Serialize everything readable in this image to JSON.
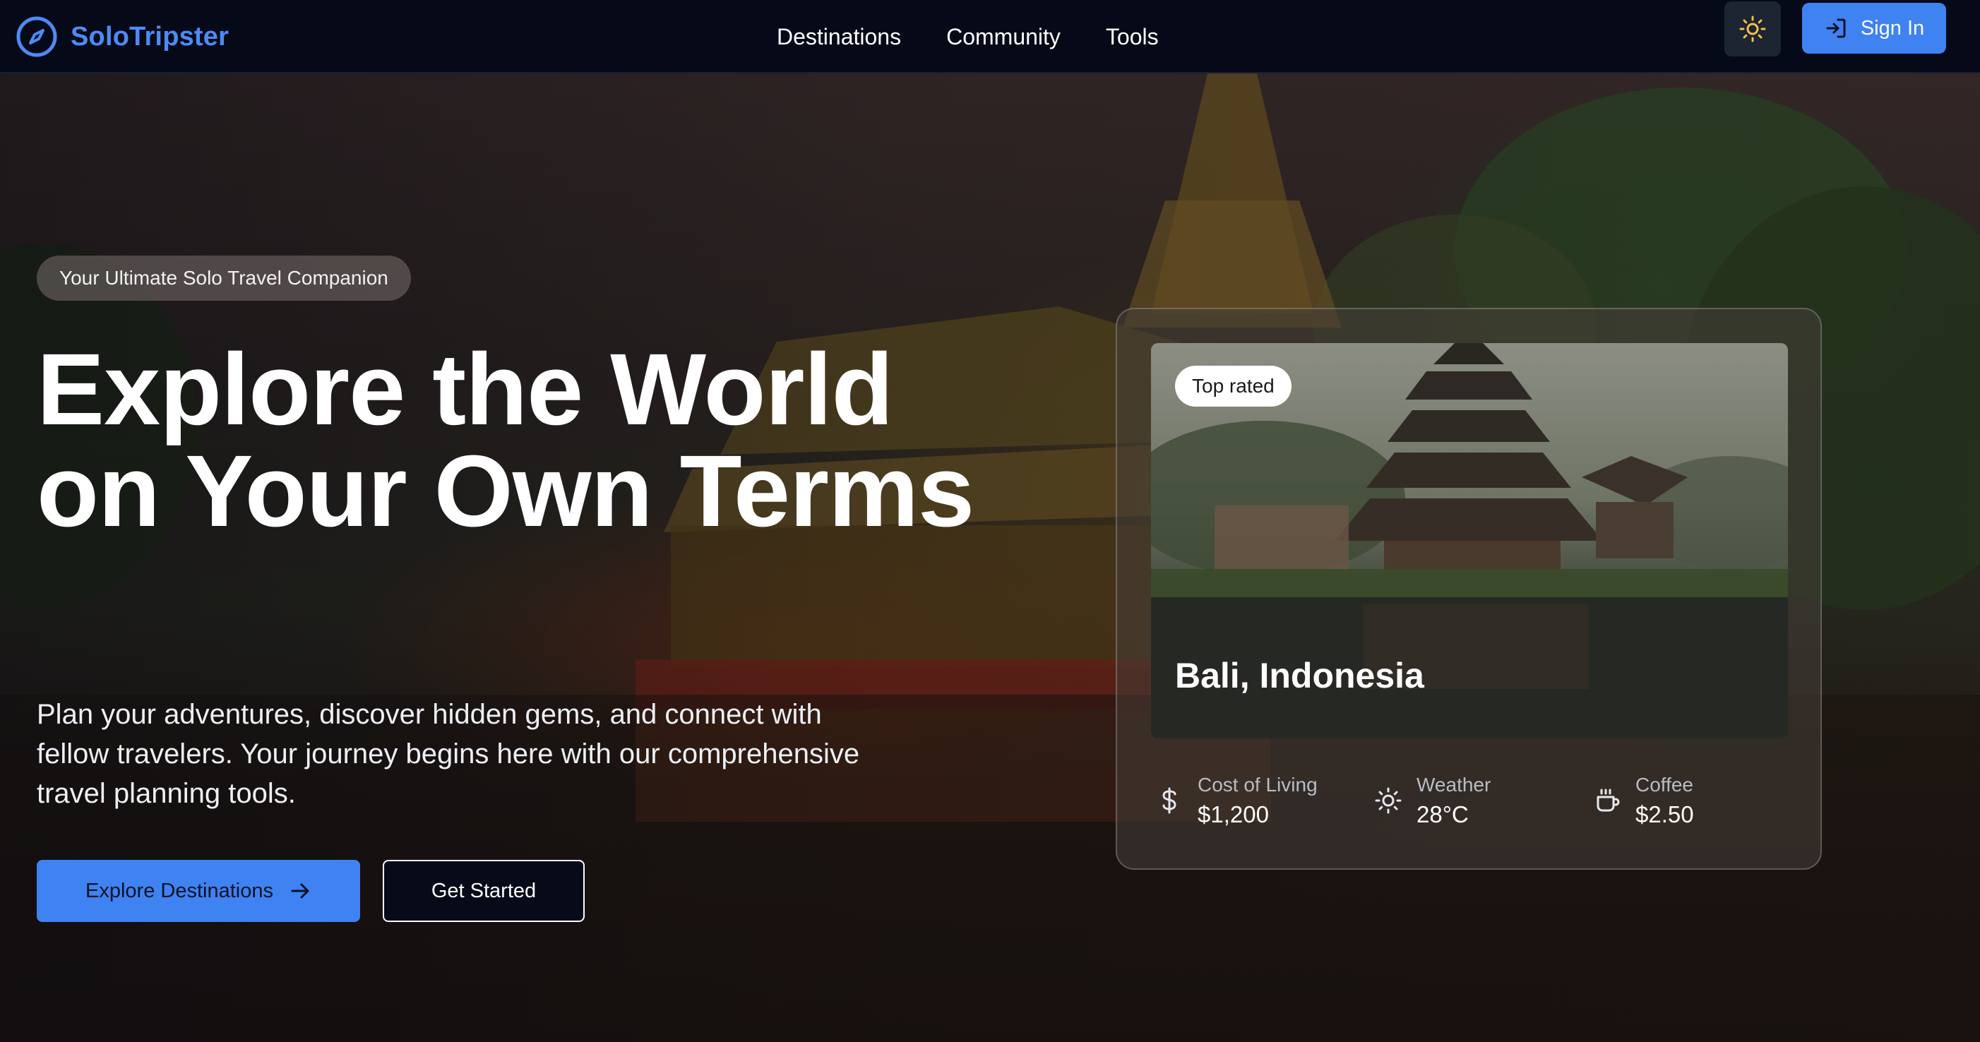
{
  "brand": {
    "name": "SoloTripster",
    "icon": "compass-icon",
    "color": "#4d8af6"
  },
  "nav": [
    {
      "label": "Destinations"
    },
    {
      "label": "Community"
    },
    {
      "label": "Tools"
    }
  ],
  "header_actions": {
    "theme_icon": "sun-icon",
    "signin_label": "Sign In",
    "signin_icon": "login-icon",
    "accent": "#3f82f2"
  },
  "hero": {
    "pill": "Your Ultimate Solo Travel Companion",
    "headline": "Explore the World on Your Own Terms",
    "subtext": "Plan your adventures, discover hidden gems, and connect with fellow travelers. Your journey begins here with our comprehensive travel planning tools.",
    "primary_cta": "Explore Destinations",
    "secondary_cta": "Get Started"
  },
  "card": {
    "badge": "Top rated",
    "place": "Bali, Indonesia",
    "stats": [
      {
        "icon": "dollar-icon",
        "label": "Cost of Living",
        "value": "$1,200"
      },
      {
        "icon": "sun-icon",
        "label": "Weather",
        "value": "28°C"
      },
      {
        "icon": "coffee-icon",
        "label": "Coffee",
        "value": "$2.50"
      }
    ]
  }
}
